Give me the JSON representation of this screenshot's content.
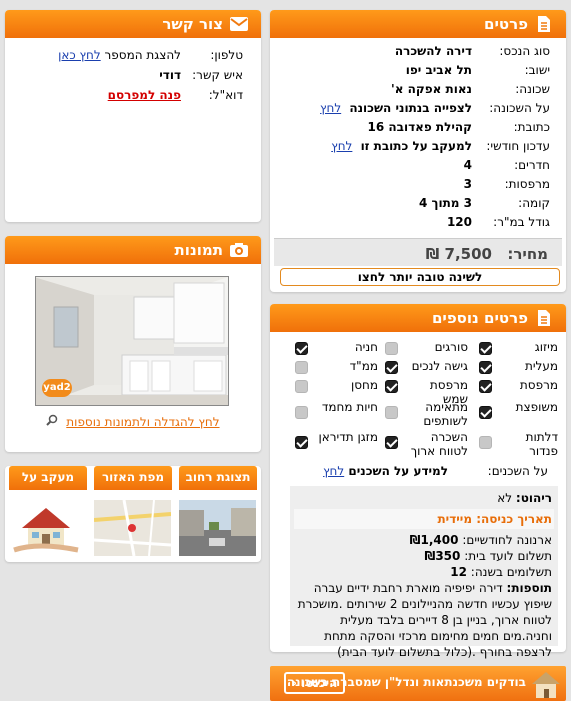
{
  "contact": {
    "title": "צור קשר",
    "phone_label": "טלפון:",
    "phone_text": "להצגת המספר",
    "phone_link": "לחץ כאן",
    "person_label": "איש קשר:",
    "person_value": "דודי",
    "email_label": "דוא\"ל:",
    "email_link": "פנה למפרסם"
  },
  "details": {
    "title": "פרטים",
    "rows": [
      {
        "label": "סוג הנכס:",
        "value": "דירה להשכרה"
      },
      {
        "label": "ישוב:",
        "value": "תל אביב יפו"
      },
      {
        "label": "שכונה:",
        "value": "נאות אפקה א'"
      },
      {
        "label": "על השכונה:",
        "value": "לצפייה בנתוני השכונה",
        "link": "לחץ"
      },
      {
        "label": "כתובת:",
        "value": "קהילת פאדובה 16"
      },
      {
        "label": "עדכון חודשי:",
        "value": "למעקב על כתובת זו",
        "link": "לחץ"
      },
      {
        "label": "חדרים:",
        "value": "4"
      },
      {
        "label": "מרפסות:",
        "value": "3"
      },
      {
        "label": "קומה:",
        "value": "3 מתוך 4"
      },
      {
        "label": "גודל במ\"ר:",
        "value": "120"
      }
    ],
    "price_label": "מחיר:",
    "price_value": "7,500 ₪",
    "banner": "לשינה טובה יותר לחצו"
  },
  "photos": {
    "title": "תמונות",
    "watermark": "yad2",
    "link": "לחץ להגדלה ולתמונות נוספות"
  },
  "maps": {
    "tabs": [
      "תצוגת רחוב",
      "מפת האזור",
      "מעקב על הנכס"
    ]
  },
  "extra": {
    "title": "פרטים נוספים",
    "features": [
      {
        "label": "מיזוג",
        "checked": true
      },
      {
        "label": "סורגים",
        "checked": false
      },
      {
        "label": "חניה",
        "checked": true
      },
      {
        "label": "מעלית",
        "checked": true
      },
      {
        "label": "גישה לנכים",
        "checked": true
      },
      {
        "label": "ממ\"ד",
        "checked": false
      },
      {
        "label": "מרפסת",
        "checked": true
      },
      {
        "label": "מרפסת שמש",
        "checked": true
      },
      {
        "label": "מחסן",
        "checked": false
      },
      {
        "label": "משופצת",
        "checked": true
      },
      {
        "label": "מתאימה לשותפים",
        "checked": false
      },
      {
        "label": "חיות מחמד",
        "checked": false
      },
      {
        "label": "דלתות פנדור",
        "checked": false
      },
      {
        "label": "השכרה לטווח ארוך",
        "checked": true
      },
      {
        "label": "מזגן תדיראן",
        "checked": true
      }
    ],
    "neighbors_label": "על השכנים:",
    "neighbors_text": "למידע על השכנים",
    "neighbors_link": "לחץ",
    "furniture_label": "ריהוט:",
    "furniture_value": "לא",
    "entry_label": "תאריך כניסה:",
    "entry_value": "מיידית",
    "arnona_label": "ארנונה לחודשיים:",
    "arnona_value": "₪1,400",
    "vaad_label": "תשלום לועד בית:",
    "vaad_value": "₪350",
    "payments_label": "תשלומים בשנה:",
    "payments_value": "12",
    "additions_label": "תוספות:",
    "additions_text": "דירה יפיפיה מוארת רחבת ידיים עברה שיפוץ עכשיו חדשה מהניילונים 2 שירותים .מושכרת לטווח ארוך, בניין בן 8 דיירים בלבד מעלית וחניה.מים חמים מחימום מרכזי והסקה מתחת לרצפה בחורף .(כלול בתשלום לועד הבית)"
  },
  "ad": {
    "text": "בודקים משכנתאות ונדל\"ן שמסברת בשכונה",
    "button": "היכנסו"
  }
}
